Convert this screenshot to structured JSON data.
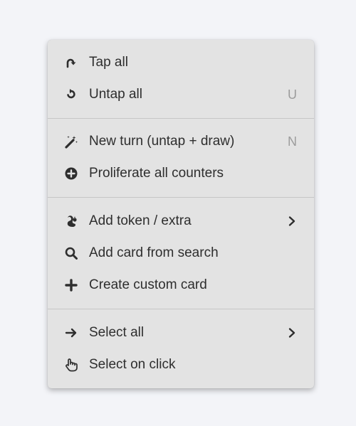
{
  "menu": {
    "groups": [
      {
        "items": [
          {
            "label": "Tap all",
            "icon": "tap-icon",
            "shortcut": ""
          },
          {
            "label": "Untap all",
            "icon": "untap-icon",
            "shortcut": "U"
          }
        ]
      },
      {
        "items": [
          {
            "label": "New turn (untap + draw)",
            "icon": "magic-wand-icon",
            "shortcut": "N"
          },
          {
            "label": "Proliferate all counters",
            "icon": "plus-circle-icon",
            "shortcut": ""
          }
        ]
      },
      {
        "items": [
          {
            "label": "Add token / extra",
            "icon": "squirrel-icon",
            "submenu": true
          },
          {
            "label": "Add card from search",
            "icon": "search-icon",
            "shortcut": ""
          },
          {
            "label": "Create custom card",
            "icon": "plus-icon",
            "shortcut": ""
          }
        ]
      },
      {
        "items": [
          {
            "label": "Select all",
            "icon": "arrow-right-icon",
            "submenu": true
          },
          {
            "label": "Select on click",
            "icon": "hand-pointer-icon",
            "shortcut": ""
          }
        ]
      }
    ]
  },
  "colors": {
    "menu_background": "#e3e3e3",
    "text": "#2e2e2e",
    "shortcut_text": "#9c9c9c",
    "separator": "#c6c6c6",
    "page_background": "#f3f4f8"
  }
}
